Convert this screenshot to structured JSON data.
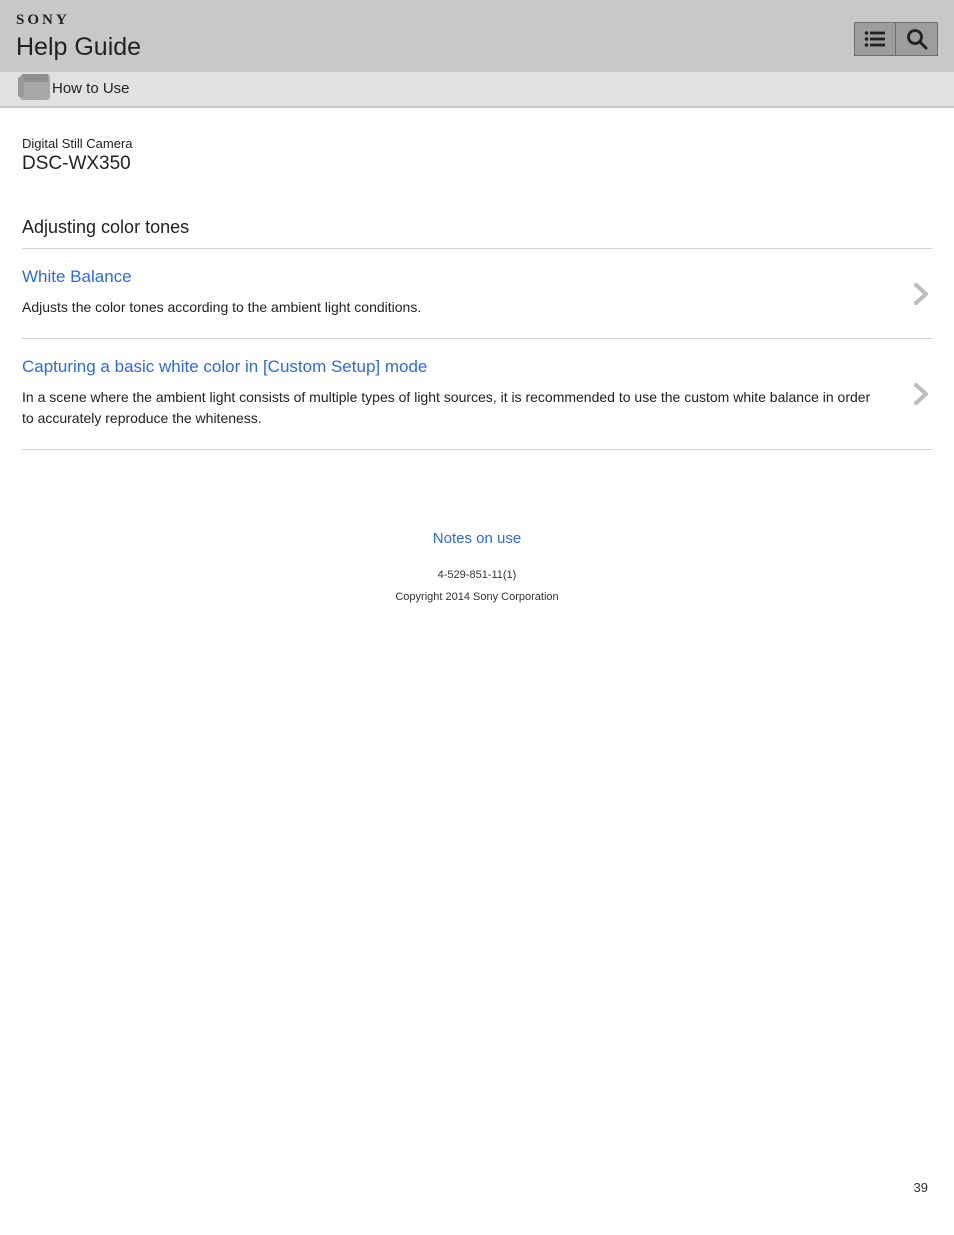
{
  "header": {
    "brand": "SONY",
    "title": "Help Guide"
  },
  "subheader": {
    "label": "How to Use"
  },
  "product": {
    "category": "Digital Still Camera",
    "model": "DSC-WX350"
  },
  "section": {
    "title": "Adjusting color tones"
  },
  "articles": [
    {
      "title": "White Balance",
      "description": "Adjusts the color tones according to the ambient light conditions."
    },
    {
      "title": "Capturing a basic white color in [Custom Setup] mode",
      "description": "In a scene where the ambient light consists of multiple types of light sources, it is recommended to use the custom white balance in order to accurately reproduce the whiteness."
    }
  ],
  "footer": {
    "notes_link": "Notes on use",
    "code": "4-529-851-11(1)",
    "copyright": "Copyright 2014 Sony Corporation"
  },
  "page_number": "39"
}
